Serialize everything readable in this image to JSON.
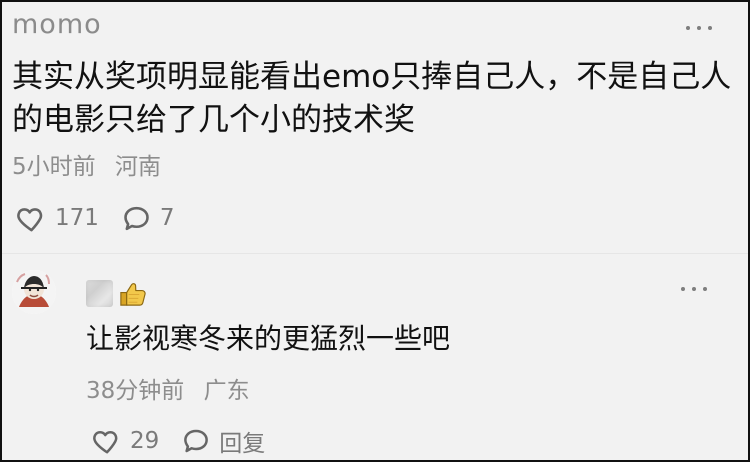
{
  "top_comment": {
    "username": "momo",
    "text": "其实从奖项明显能看出emo只捧自己人，不是自己人的电影只给了几个小的技术奖",
    "time": "5小时前",
    "location": "河南",
    "like_count": "171",
    "reply_count": "7",
    "icons": {
      "more": "more-horizontal-icon",
      "like": "heart-icon",
      "comment": "comment-bubble-icon"
    }
  },
  "reply_comment": {
    "text": "让影视寒冬来的更猛烈一些吧",
    "time": "38分钟前",
    "location": "广东",
    "like_count": "29",
    "reply_label": "回复",
    "icons": {
      "avatar": "avatar-image",
      "badge": "thumbs-up-icon",
      "more": "more-horizontal-icon",
      "like": "heart-icon",
      "reply": "comment-bubble-icon"
    }
  },
  "colors": {
    "background": "#f2f2f2",
    "primary_text": "#111111",
    "secondary_text": "#8d8d8d",
    "icon": "#7a7a7a",
    "thumb": "#f2c84b"
  }
}
